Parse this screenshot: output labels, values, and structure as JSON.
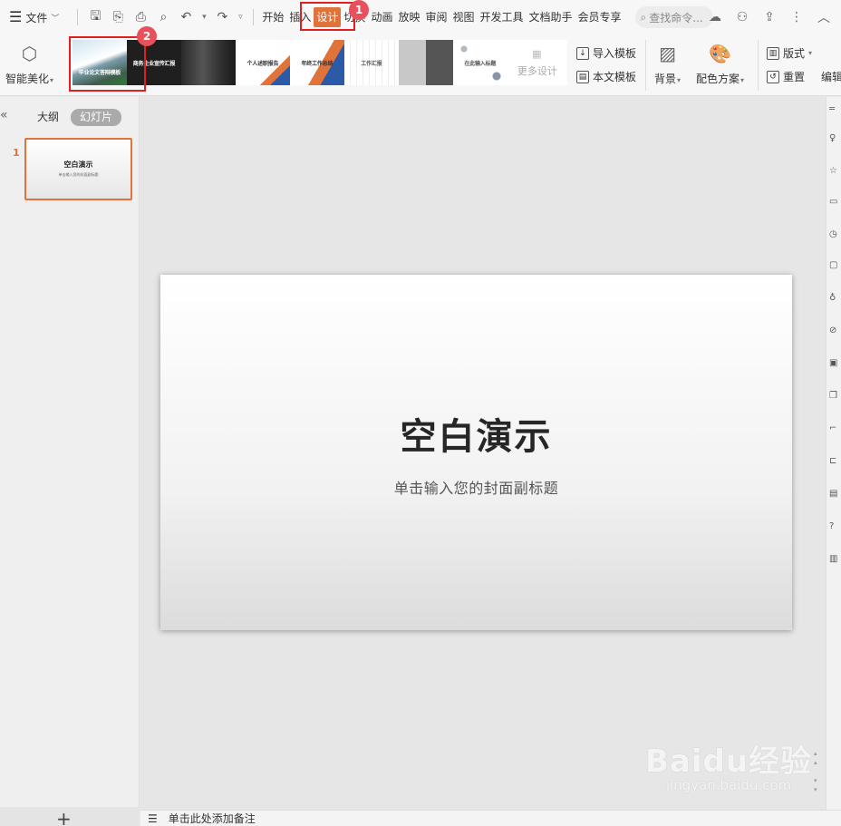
{
  "topbar": {
    "menu_label": "文件",
    "tabs": [
      "开始",
      "插入",
      "设计",
      "切换",
      "动画",
      "放映",
      "审阅",
      "视图",
      "开发工具",
      "文档助手",
      "会员专享"
    ],
    "active_tab": "设计",
    "search_placeholder": "查找命令..."
  },
  "annotations": {
    "badge_1": "1",
    "badge_2": "2",
    "highlight_color": "#e02020",
    "badge_color": "#e8505b"
  },
  "ribbon": {
    "smart_beautify": "智能美化",
    "templates": [
      {
        "name": "mountain",
        "text": "毕业论文答辩模板"
      },
      {
        "name": "dark-title",
        "text": "商务企业宣传汇报"
      },
      {
        "name": "city-night",
        "text": ""
      },
      {
        "name": "personal-report",
        "text": "个人述职报告"
      },
      {
        "name": "orange-blue",
        "text": "年终工作总结"
      },
      {
        "name": "gray-lines",
        "text": "工作汇报"
      },
      {
        "name": "photo-panel",
        "text": ""
      },
      {
        "name": "dots",
        "text": "在此输入标题"
      }
    ],
    "more_designs": "更多设计",
    "import_template": "导入模板",
    "this_template": "本文模板",
    "background": "背景",
    "color_scheme": "配色方案",
    "layout": "版式",
    "reset": "重置",
    "edit": "编辑",
    "accent_color": "#e0733a"
  },
  "left_pane": {
    "outline_tab": "大纲",
    "slides_tab": "幻灯片",
    "slide_number": "1",
    "thumb_title": "空白演示",
    "thumb_subtitle": "单击输入您的封面副标题",
    "add_slide": "+"
  },
  "slide": {
    "title": "空白演示",
    "subtitle": "单击输入您的封面副标题"
  },
  "notes": {
    "placeholder": "单击此处添加备注"
  },
  "watermark": {
    "line1": "Baidu经验",
    "line2": "jingyan.baidu.com"
  }
}
